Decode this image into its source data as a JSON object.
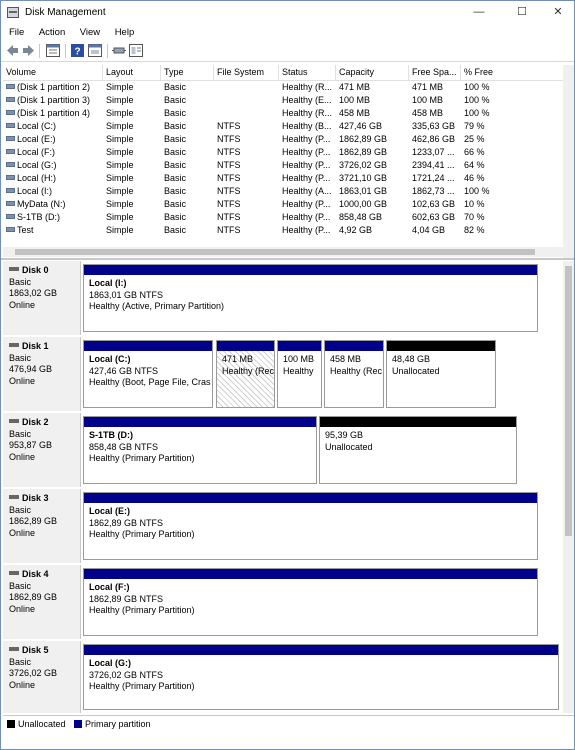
{
  "window": {
    "title": "Disk Management",
    "controls": {
      "min": "—",
      "max": "☐",
      "close": "✕"
    }
  },
  "menu": [
    "File",
    "Action",
    "View",
    "Help"
  ],
  "columns": [
    "Volume",
    "Layout",
    "Type",
    "File System",
    "Status",
    "Capacity",
    "Free Spa...",
    "% Free"
  ],
  "volumes": [
    [
      "(Disk 1 partition 2)",
      "Simple",
      "Basic",
      "",
      "Healthy (R...",
      "471 MB",
      "471 MB",
      "100 %"
    ],
    [
      "(Disk 1 partition 3)",
      "Simple",
      "Basic",
      "",
      "Healthy (E...",
      "100 MB",
      "100 MB",
      "100 %"
    ],
    [
      "(Disk 1 partition 4)",
      "Simple",
      "Basic",
      "",
      "Healthy (R...",
      "458 MB",
      "458 MB",
      "100 %"
    ],
    [
      "Local (C:)",
      "Simple",
      "Basic",
      "NTFS",
      "Healthy (B...",
      "427,46 GB",
      "335,63 GB",
      "79 %"
    ],
    [
      "Local (E:)",
      "Simple",
      "Basic",
      "NTFS",
      "Healthy (P...",
      "1862,89 GB",
      "462,86 GB",
      "25 %"
    ],
    [
      "Local (F:)",
      "Simple",
      "Basic",
      "NTFS",
      "Healthy (P...",
      "1862,89 GB",
      "1233,07 ...",
      "66 %"
    ],
    [
      "Local (G:)",
      "Simple",
      "Basic",
      "NTFS",
      "Healthy (P...",
      "3726,02 GB",
      "2394,41 ...",
      "64 %"
    ],
    [
      "Local (H:)",
      "Simple",
      "Basic",
      "NTFS",
      "Healthy (P...",
      "3721,10 GB",
      "1721,24 ...",
      "46 %"
    ],
    [
      "Local (I:)",
      "Simple",
      "Basic",
      "NTFS",
      "Healthy (A...",
      "1863,01 GB",
      "1862,73 ...",
      "100 %"
    ],
    [
      "MyData (N:)",
      "Simple",
      "Basic",
      "NTFS",
      "Healthy (P...",
      "1000,00 GB",
      "102,63 GB",
      "10 %"
    ],
    [
      "S-1TB (D:)",
      "Simple",
      "Basic",
      "NTFS",
      "Healthy (P...",
      "858,48 GB",
      "602,63 GB",
      "70 %"
    ],
    [
      "Test",
      "Simple",
      "Basic",
      "NTFS",
      "Healthy (P...",
      "4,92 GB",
      "4,04 GB",
      "82 %"
    ]
  ],
  "disks": [
    {
      "name": "Disk 0",
      "type": "Basic",
      "size": "1863,02 GB",
      "status": "Online",
      "partitions": [
        {
          "kind": "primary",
          "title": "Local  (I:)",
          "line2": "1863,01 GB NTFS",
          "line3": "Healthy (Active, Primary Partition)"
        }
      ]
    },
    {
      "name": "Disk 1",
      "type": "Basic",
      "size": "476,94 GB",
      "status": "Online",
      "partitions": [
        {
          "kind": "primary",
          "title": "Local  (C:)",
          "line2": "427,46 GB NTFS",
          "line3": "Healthy (Boot, Page File, Cras"
        },
        {
          "kind": "primary",
          "title": "",
          "line2": "471 MB",
          "line3": "Healthy (Rec"
        },
        {
          "kind": "primary",
          "title": "",
          "line2": "100 MB",
          "line3": "Healthy"
        },
        {
          "kind": "primary",
          "title": "",
          "line2": "458 MB",
          "line3": "Healthy (Rec"
        },
        {
          "kind": "unallocated",
          "title": "",
          "line2": "48,48 GB",
          "line3": "Unallocated"
        }
      ]
    },
    {
      "name": "Disk 2",
      "type": "Basic",
      "size": "953,87 GB",
      "status": "Online",
      "partitions": [
        {
          "kind": "primary",
          "title": "S-1TB  (D:)",
          "line2": "858,48 GB NTFS",
          "line3": "Healthy (Primary Partition)"
        },
        {
          "kind": "unallocated",
          "title": "",
          "line2": "95,39 GB",
          "line3": "Unallocated"
        }
      ]
    },
    {
      "name": "Disk 3",
      "type": "Basic",
      "size": "1862,89 GB",
      "status": "Online",
      "partitions": [
        {
          "kind": "primary",
          "title": "Local  (E:)",
          "line2": "1862,89 GB NTFS",
          "line3": "Healthy (Primary Partition)"
        }
      ]
    },
    {
      "name": "Disk 4",
      "type": "Basic",
      "size": "1862,89 GB",
      "status": "Online",
      "partitions": [
        {
          "kind": "primary",
          "title": "Local  (F:)",
          "line2": "1862,89 GB NTFS",
          "line3": "Healthy (Primary Partition)"
        }
      ]
    },
    {
      "name": "Disk 5",
      "type": "Basic",
      "size": "3726,02 GB",
      "status": "Online",
      "partitions": [
        {
          "kind": "primary",
          "title": "Local  (G:)",
          "line2": "3726,02 GB NTFS",
          "line3": "Healthy (Primary Partition)"
        }
      ]
    }
  ],
  "legend": [
    {
      "label": "Unallocated",
      "color": "#000000"
    },
    {
      "label": "Primary partition",
      "color": "#00008b"
    }
  ],
  "colors": {
    "primary": "#00008b",
    "unallocated": "#000000"
  }
}
